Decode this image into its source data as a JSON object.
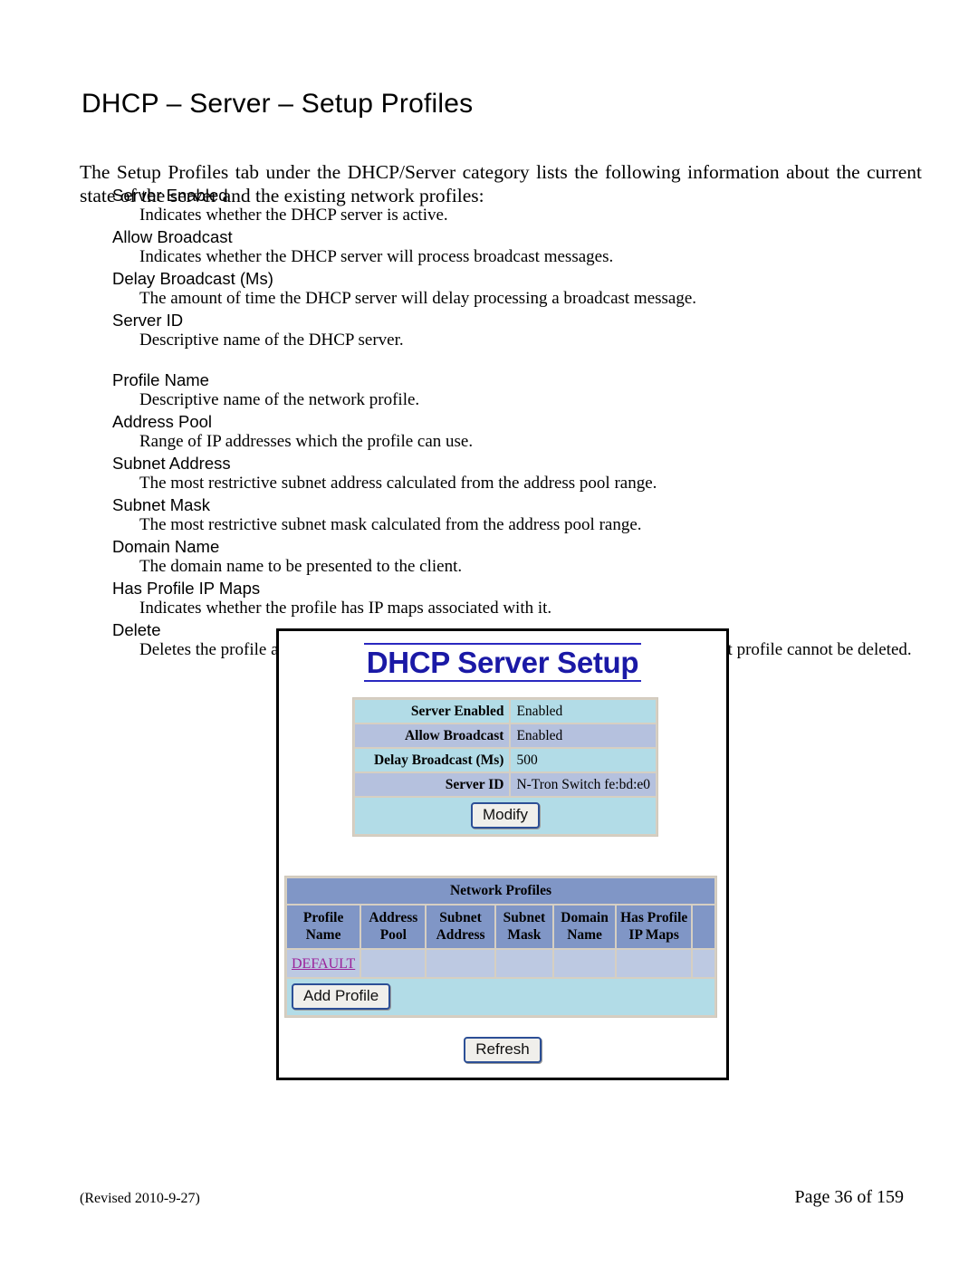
{
  "document": {
    "title": "DHCP – Server – Setup Profiles",
    "intro": "The Setup Profiles tab under the DHCP/Server category lists the following information about the current state of the server and the existing network profiles:"
  },
  "definitions": [
    {
      "term": "Server Enabled",
      "desc": "Indicates whether the DHCP server is active."
    },
    {
      "term": "Allow Broadcast",
      "desc": "Indicates whether the DHCP server will process broadcast messages."
    },
    {
      "term": "Delay Broadcast (Ms)",
      "desc": "The amount of time the DHCP server will delay processing a broadcast message."
    },
    {
      "term": "Server ID",
      "desc": "Descriptive name of the DHCP server."
    },
    {
      "term": "Profile Name",
      "desc": "Descriptive name of the network profile."
    },
    {
      "term": "Address Pool",
      "desc": "Range of IP addresses which the profile can use."
    },
    {
      "term": "Subnet Address",
      "desc": "The most restrictive subnet address calculated from the address pool range."
    },
    {
      "term": "Subnet Mask",
      "desc": "The most restrictive subnet mask calculated from the address pool range."
    },
    {
      "term": "Domain Name",
      "desc": "The domain name to be presented to the client."
    },
    {
      "term": "Has Profile IP Maps",
      "desc": "Indicates whether the profile has IP maps associated with it."
    },
    {
      "term": "Delete",
      "desc": "Deletes the profile along with all IP maps and bindings associated with it.  The Default profile cannot be deleted."
    }
  ],
  "screenshot": {
    "heading": "DHCP Server Setup",
    "settings": {
      "rows": [
        {
          "label": "Server Enabled",
          "value": "Enabled"
        },
        {
          "label": "Allow Broadcast",
          "value": "Enabled"
        },
        {
          "label": "Delay Broadcast (Ms)",
          "value": "500"
        },
        {
          "label": "Server ID",
          "value": "N-Tron Switch fe:bd:e0"
        }
      ],
      "modify_label": "Modify"
    },
    "profiles": {
      "banner": "Network Profiles",
      "columns": [
        "Profile Name",
        "Address Pool",
        "Subnet Address",
        "Subnet Mask",
        "Domain Name",
        "Has Profile IP Maps",
        ""
      ],
      "rows": [
        {
          "profile_name": "DEFAULT",
          "address_pool": "",
          "subnet_address": "",
          "subnet_mask": "",
          "domain_name": "",
          "has_profile_ip_maps": "",
          "delete": ""
        }
      ],
      "add_profile_label": "Add Profile"
    },
    "refresh_label": "Refresh",
    "colors": {
      "heading": "#1a19a6",
      "row_cyan": "#b2dce7",
      "row_blue": "#b5c1de",
      "header_blue": "#8096c6",
      "cell_blue": "#bdc9e2",
      "link_purple": "#9a219a",
      "button_border": "#2c4f96"
    }
  },
  "footer": {
    "revised": "(Revised 2010-9-27)",
    "page": "Page 36 of 159"
  }
}
